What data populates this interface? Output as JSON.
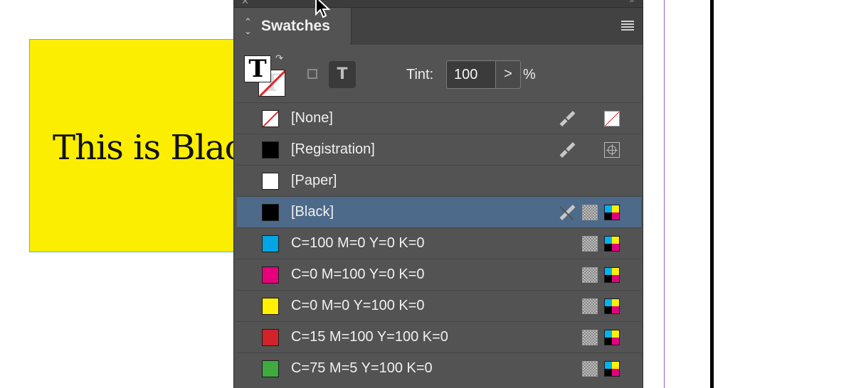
{
  "document": {
    "frame_text": "This is Black",
    "frame_fill": "#fcee00"
  },
  "panel": {
    "title": "Swatches",
    "tint_label": "Tint:",
    "tint_value": "100",
    "tint_unit": "%",
    "fill_stroke_glyph": "T",
    "format_text_glyph": "T",
    "stepper_glyph": ">",
    "swatches": [
      {
        "name": "[None]",
        "color": "none",
        "non_editable": true,
        "type_icon": "none-icon",
        "selected": false
      },
      {
        "name": "[Registration]",
        "color": "#000000",
        "non_editable": true,
        "type_icon": "registration-icon",
        "selected": false
      },
      {
        "name": "[Paper]",
        "color": "#ffffff",
        "non_editable": false,
        "type_icon": "",
        "selected": false
      },
      {
        "name": "[Black]",
        "color": "#000000",
        "non_editable": true,
        "type_icon": "cmyk-icon",
        "selected": true
      },
      {
        "name": "C=100 M=0 Y=0 K=0",
        "color": "#00a6e3",
        "non_editable": false,
        "type_icon": "cmyk-icon",
        "selected": false
      },
      {
        "name": "C=0 M=100 Y=0 K=0",
        "color": "#e6007e",
        "non_editable": false,
        "type_icon": "cmyk-icon",
        "selected": false
      },
      {
        "name": "C=0 M=0 Y=100 K=0",
        "color": "#fff100",
        "non_editable": false,
        "type_icon": "cmyk-icon",
        "selected": false
      },
      {
        "name": "C=15 M=100 Y=100 K=0",
        "color": "#d2232a",
        "non_editable": false,
        "type_icon": "cmyk-icon",
        "selected": false
      },
      {
        "name": "C=75 M=5 Y=100 K=0",
        "color": "#3fab3f",
        "non_editable": false,
        "type_icon": "cmyk-icon",
        "selected": false
      }
    ]
  },
  "colors": {
    "selection": "#4d6a8a",
    "panel_bg": "#535353",
    "guide": "#9b5fd6"
  }
}
